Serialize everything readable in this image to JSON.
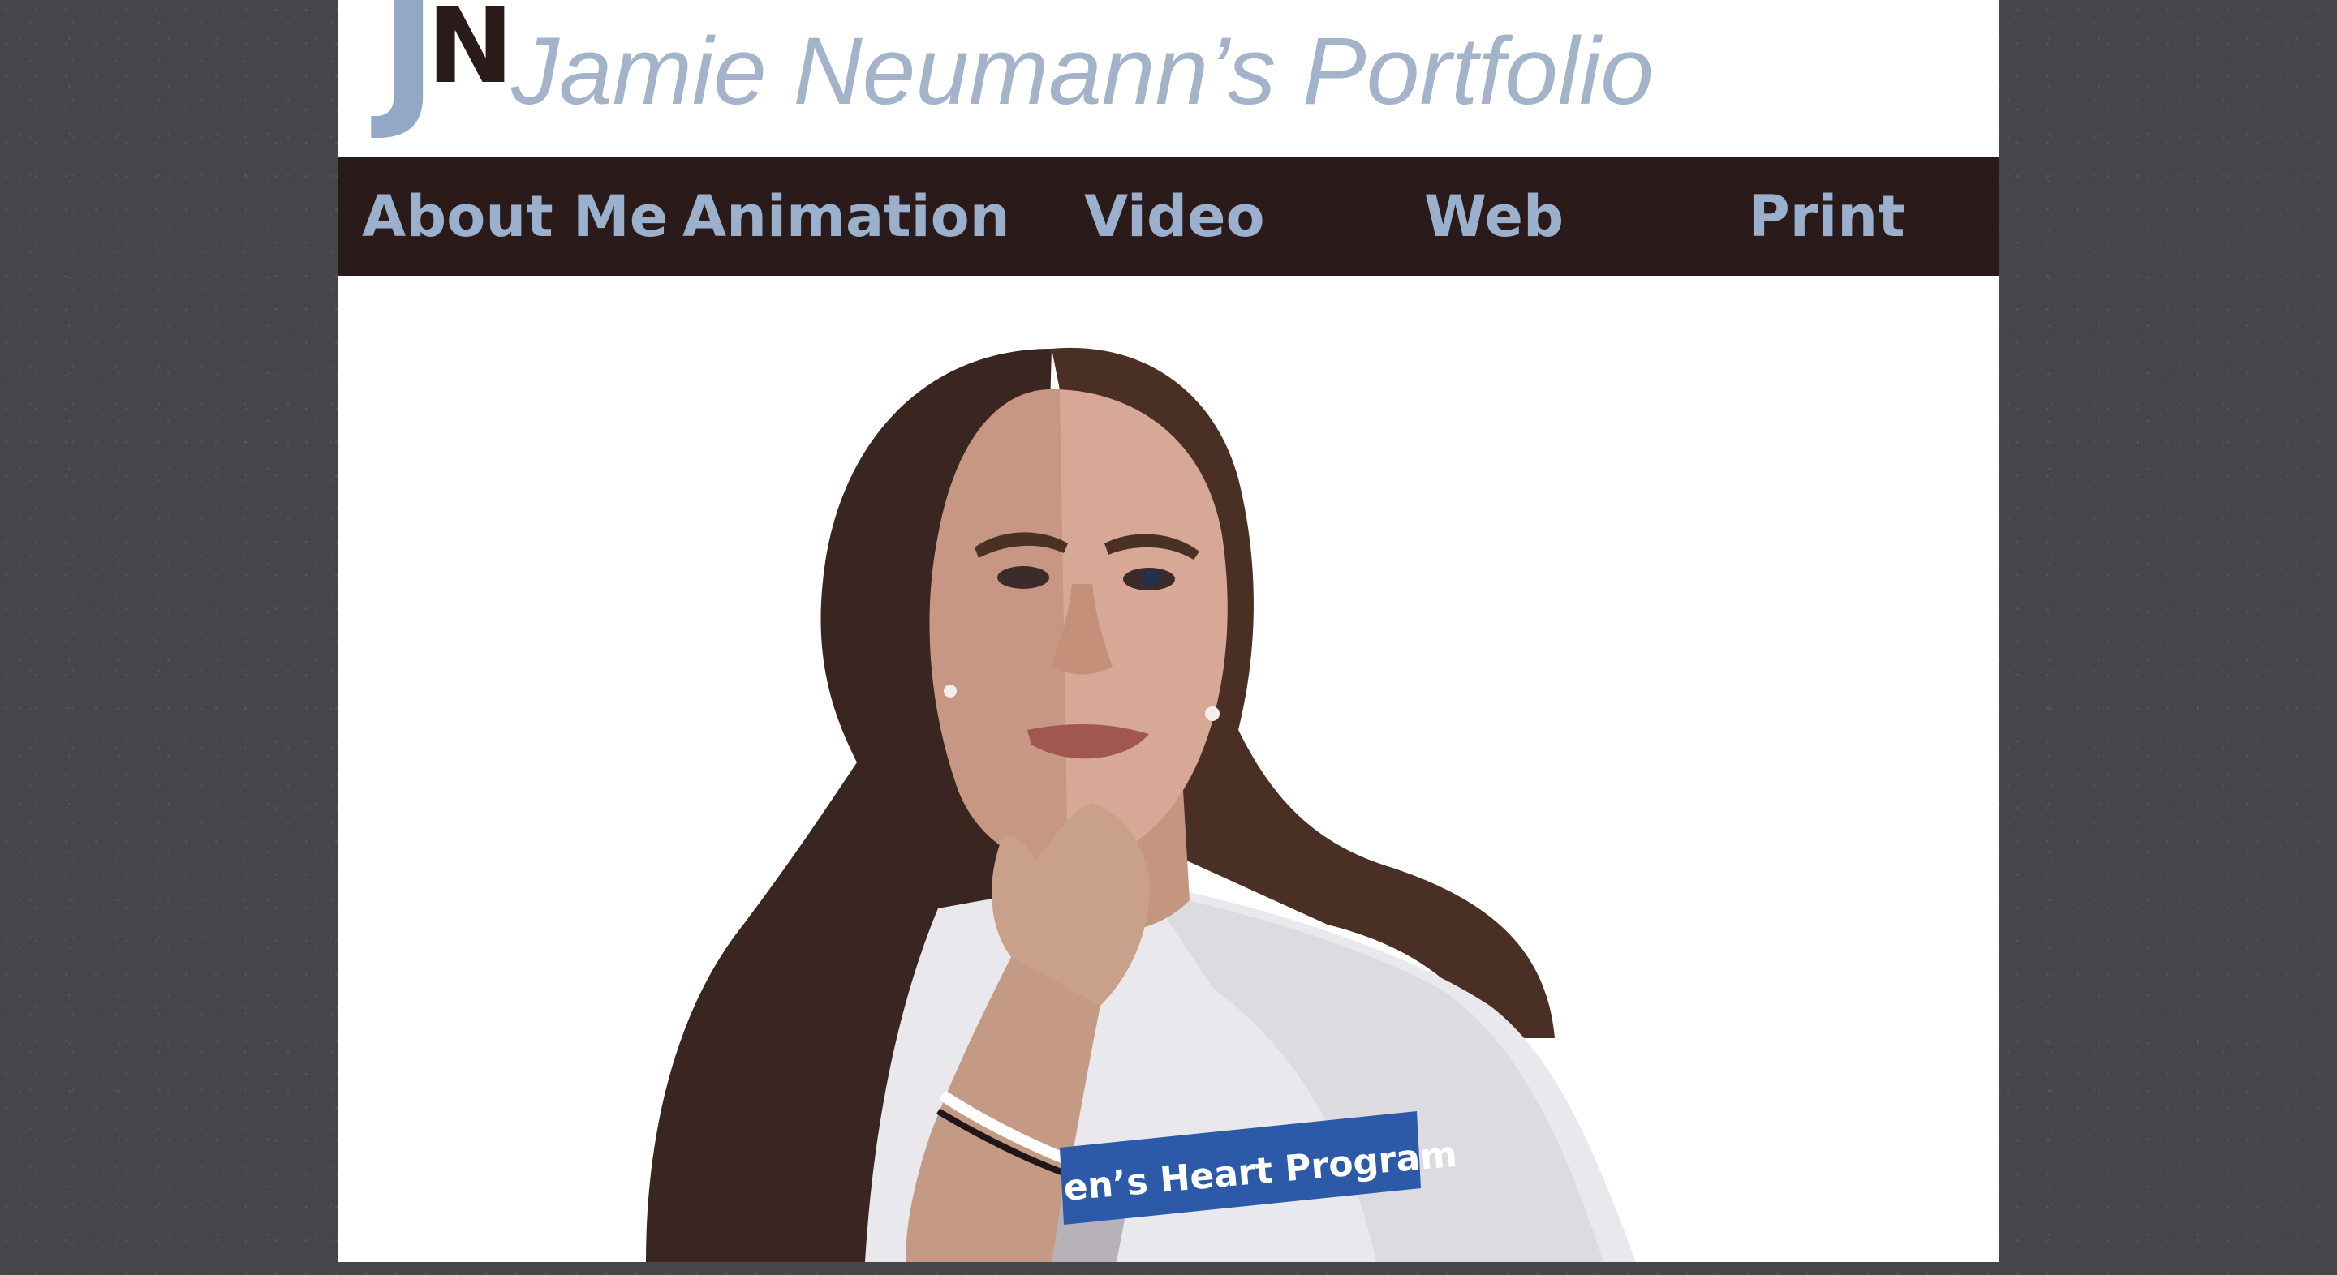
{
  "site": {
    "logo": {
      "letter_1": "J",
      "letter_2": "N",
      "color_1": "#92a8c4",
      "color_2": "#2a1b1a"
    },
    "title": "Jamie Neumann’s Portfolio"
  },
  "nav": {
    "items": [
      {
        "label": "About Me"
      },
      {
        "label": "Animation"
      },
      {
        "label": "Video"
      },
      {
        "label": "Web"
      },
      {
        "label": "Print"
      }
    ],
    "background": "#2a1b1a",
    "text_color": "#9bb0cc"
  },
  "hero": {
    "image": "stylized-portrait-illustration",
    "shirt_text": "en’s Heart Program",
    "banner_color": "#2c5aa8"
  },
  "colors": {
    "page_background": "#45464a",
    "content_background": "#ffffff"
  }
}
